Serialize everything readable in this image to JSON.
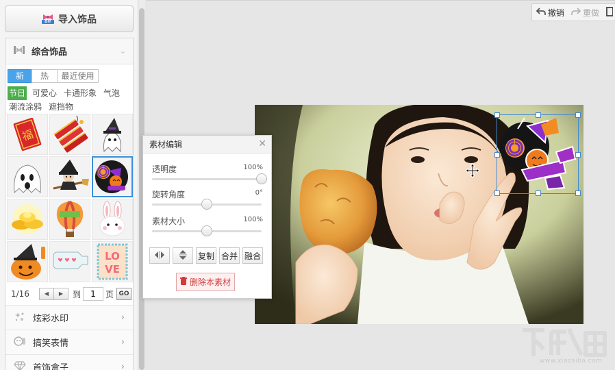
{
  "sidebar": {
    "import_label": "导入饰品",
    "panel_title": "综合饰品",
    "tabs": [
      {
        "label": "新",
        "active": true
      },
      {
        "label": "热",
        "active": false
      },
      {
        "label": "最近使用",
        "active": false
      }
    ],
    "categories": [
      {
        "label": "节日",
        "active": true
      },
      {
        "label": "可爱心",
        "active": false
      },
      {
        "label": "卡通形象",
        "active": false
      },
      {
        "label": "气泡",
        "active": false
      },
      {
        "label": "潮流涂鸦",
        "active": false
      },
      {
        "label": "遮挡物",
        "active": false
      }
    ],
    "stickers": [
      "red-envelope-fu-icon",
      "firecrackers-icon",
      "ghost-witch-hat-icon",
      "ghost-icon",
      "witch-broom-icon",
      "halloween-lollipop-icon",
      "gold-ingots-icon",
      "hot-air-balloon-icon",
      "bunny-icon",
      "pumpkin-icon",
      "message-bottle-icon",
      "love-stamp-icon"
    ],
    "pager": {
      "page_indicator": "1/16",
      "to_label": "到",
      "page_input": "1",
      "page_suffix": "页",
      "go_label": "GO"
    },
    "menu_items": [
      {
        "label": "炫彩水印",
        "icon": "sparkle-icon"
      },
      {
        "label": "搞笑表情",
        "icon": "face-icon"
      },
      {
        "label": "首饰盒子",
        "icon": "diamond-icon"
      }
    ]
  },
  "toolbar": {
    "undo_label": "撤销",
    "redo_label": "重做"
  },
  "editor": {
    "title": "素材编辑",
    "sliders": [
      {
        "label": "透明度",
        "value": "100%",
        "level": 1.0
      },
      {
        "label": "旋转角度",
        "value": "0°",
        "level": 0.5
      },
      {
        "label": "素材大小",
        "value": "100%",
        "level": 0.5
      }
    ],
    "tools": {
      "flip_h": "flip-horizontal-icon",
      "flip_v": "flip-vertical-icon",
      "copy_label": "复制",
      "merge_label": "合并",
      "blend_label": "融合"
    },
    "delete_label": "删除本素材"
  },
  "watermark": {
    "site": "www.xiazaiba.com"
  },
  "colors": {
    "accent_blue": "#4aa3e8",
    "active_green": "#4cae4c",
    "delete_red": "#d23b3b",
    "selection_blue": "#3f8ad6"
  }
}
